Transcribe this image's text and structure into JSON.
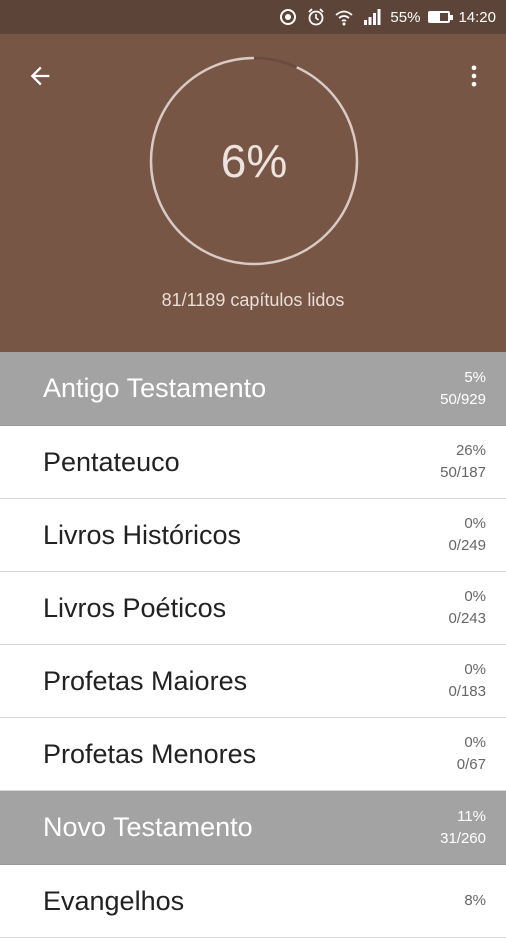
{
  "status_bar": {
    "icons": [
      "sync-icon",
      "alarm-icon",
      "wifi-icon",
      "signal-icon",
      "battery-icon"
    ],
    "battery": "55%",
    "time": "14:20"
  },
  "header": {
    "percent_label": "6%",
    "progress_fraction": 0.068,
    "chapters_read": "81/1189 capítulos lidos",
    "colors": {
      "header_bg": "#785646",
      "status_bg": "#5c4538",
      "ring": "#d9cbc4"
    }
  },
  "list": {
    "rows": [
      {
        "title": "Antigo Testamento",
        "percent": "5%",
        "count": "50/929",
        "section": true
      },
      {
        "title": "Pentateuco",
        "percent": "26%",
        "count": "50/187",
        "section": false
      },
      {
        "title": "Livros Históricos",
        "percent": "0%",
        "count": "0/249",
        "section": false
      },
      {
        "title": "Livros Poéticos",
        "percent": "0%",
        "count": "0/243",
        "section": false
      },
      {
        "title": "Profetas Maiores",
        "percent": "0%",
        "count": "0/183",
        "section": false
      },
      {
        "title": "Profetas Menores",
        "percent": "0%",
        "count": "0/67",
        "section": false
      },
      {
        "title": "Novo Testamento",
        "percent": "11%",
        "count": "31/260",
        "section": true
      },
      {
        "title": "Evangelhos",
        "percent": "8%",
        "count": "",
        "section": false
      }
    ]
  }
}
